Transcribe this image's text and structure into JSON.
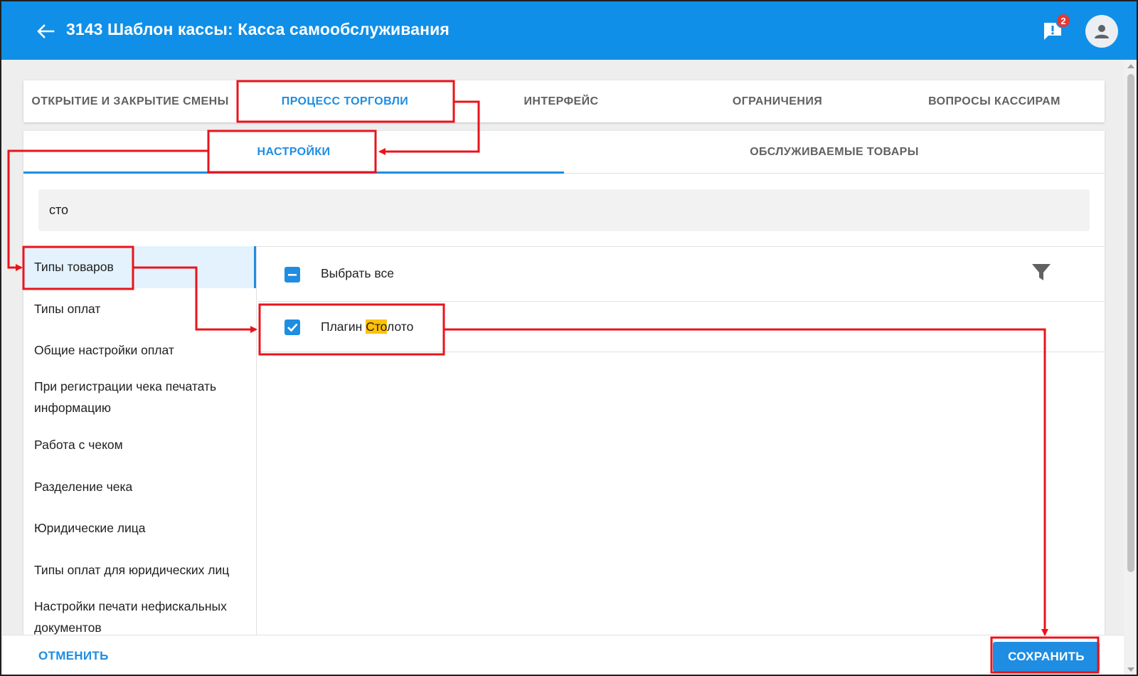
{
  "header": {
    "title": "3143 Шаблон кассы: Касса самообслуживания",
    "notification_count": "2",
    "accent_color": "#0f8fe8"
  },
  "top_tabs": [
    {
      "label": "ОТКРЫТИЕ И ЗАКРЫТИЕ СМЕНЫ",
      "active": false
    },
    {
      "label": "ПРОЦЕСС ТОРГОВЛИ",
      "active": true
    },
    {
      "label": "ИНТЕРФЕЙС",
      "active": false
    },
    {
      "label": "ОГРАНИЧЕНИЯ",
      "active": false
    },
    {
      "label": "ВОПРОСЫ КАССИРАМ",
      "active": false
    }
  ],
  "sub_tabs": [
    {
      "label": "НАСТРОЙКИ",
      "active": true
    },
    {
      "label": "ОБСЛУЖИВАЕМЫЕ ТОВАРЫ",
      "active": false
    }
  ],
  "search": {
    "value": "сто"
  },
  "settings_list": [
    {
      "label": "Типы товаров",
      "active": true
    },
    {
      "label": "Типы оплат",
      "active": false
    },
    {
      "label": "Общие настройки оплат",
      "active": false
    },
    {
      "label": "При регистрации чека печатать информацию",
      "active": false
    },
    {
      "label": "Работа с чеком",
      "active": false
    },
    {
      "label": "Разделение чека",
      "active": false
    },
    {
      "label": "Юридические лица",
      "active": false
    },
    {
      "label": "Типы оплат для юридических лиц",
      "active": false
    },
    {
      "label": "Настройки печати нефискальных документов",
      "active": false
    }
  ],
  "items_pane": {
    "select_all_label": "Выбрать все",
    "select_all_state": "indeterminate",
    "items": [
      {
        "label_before": "Плагин ",
        "label_highlight": "Сто",
        "label_after": "лото",
        "checked": true
      }
    ]
  },
  "footer": {
    "cancel_label": "ОТМЕНИТЬ",
    "save_label": "СОХРАНИТЬ"
  },
  "colors": {
    "primary": "#1e8de2",
    "highlight": "#ffc107",
    "annotation": "#e8141c"
  }
}
